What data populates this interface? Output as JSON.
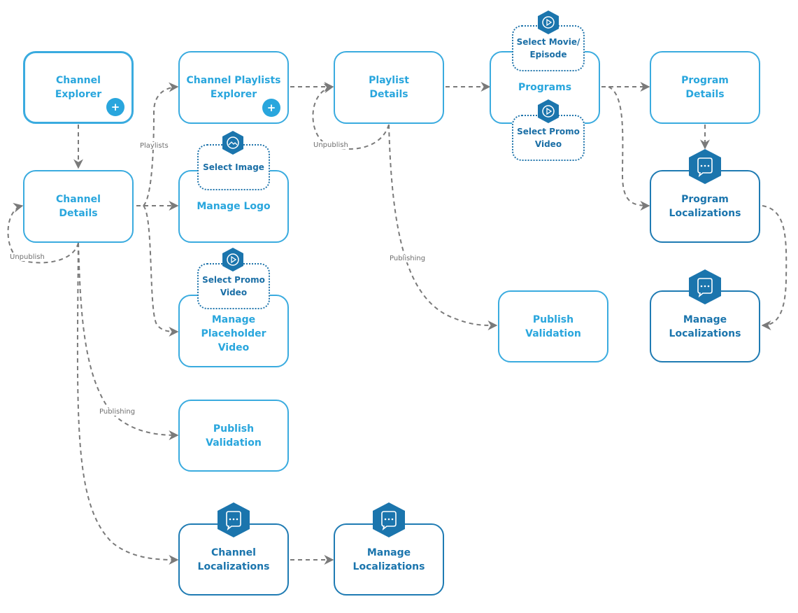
{
  "nodes": {
    "channel_explorer": {
      "label": "Channel\nExplorer"
    },
    "channel_playlists_explorer": {
      "label": "Channel Playlists\nExplorer"
    },
    "playlist_details": {
      "label": "Playlist\nDetails"
    },
    "programs": {
      "label": "Programs"
    },
    "program_details": {
      "label": "Program\nDetails"
    },
    "channel_details": {
      "label": "Channel\nDetails"
    },
    "manage_logo": {
      "label": "Manage Logo"
    },
    "program_localizations": {
      "label": "Program\nLocalizations"
    },
    "manage_placeholder_video": {
      "label": "Manage\nPlaceholder\nVideo"
    },
    "publish_validation_right": {
      "label": "Publish\nValidation"
    },
    "manage_localizations_right": {
      "label": "Manage\nLocalizations"
    },
    "publish_validation_left": {
      "label": "Publish\nValidation"
    },
    "channel_localizations": {
      "label": "Channel\nLocalizations"
    },
    "manage_localizations_bottom": {
      "label": "Manage\nLocalizations"
    }
  },
  "subnodes": {
    "select_image": {
      "label": "Select Image",
      "icon": "image-icon"
    },
    "select_promo_video_left": {
      "label": "Select Promo\nVideo",
      "icon": "play-icon"
    },
    "select_movie_episode": {
      "label": "Select Movie/\nEpisode",
      "icon": "play-icon"
    },
    "select_promo_video_programs": {
      "label": "Select Promo\nVideo",
      "icon": "play-icon"
    }
  },
  "buttons": {
    "add_symbol": "+"
  },
  "edge_labels": {
    "playlists": "Playlists",
    "unpublish_channel": "Unpublish",
    "unpublish_playlist": "Unpublish",
    "publishing_channel": "Publishing",
    "publishing_playlist": "Publishing"
  },
  "colors": {
    "node_border": "#3aabdf",
    "node_text": "#29a6dd",
    "localization_border": "#1f7bb3",
    "icon_badge": "#1b75ad",
    "edge": "#7a7a7a"
  }
}
